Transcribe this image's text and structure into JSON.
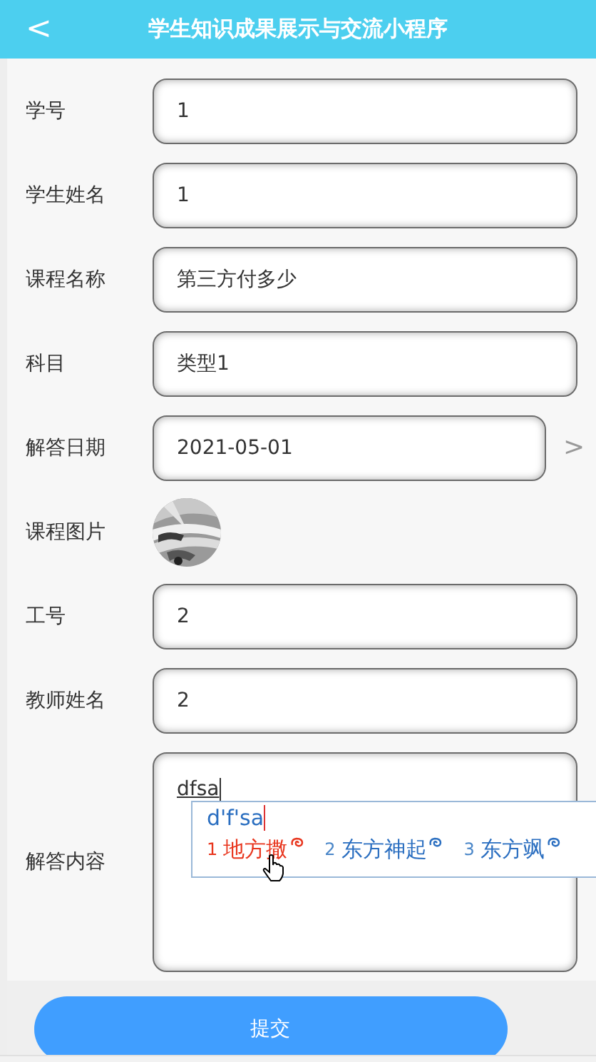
{
  "header": {
    "back": "<",
    "title": "学生知识成果展示与交流小程序"
  },
  "fields": [
    {
      "kind": "input",
      "label": "学号",
      "value": "1"
    },
    {
      "kind": "input",
      "label": "学生姓名",
      "value": "1"
    },
    {
      "kind": "input",
      "label": "课程名称",
      "value": "第三方付多少"
    },
    {
      "kind": "input",
      "label": "科目",
      "value": "类型1"
    },
    {
      "kind": "date",
      "label": "解答日期",
      "value": "2021-05-01",
      "chevron": ">"
    },
    {
      "label": "课程图片"
    },
    {
      "kind": "input",
      "label": "工号",
      "value": "2"
    },
    {
      "kind": "input",
      "label": "教师姓名",
      "value": "2"
    },
    {
      "kind": "textarea",
      "label": "解答内容",
      "value": "dfsa"
    }
  ],
  "ime": {
    "composition": "d'f'sa",
    "candidates": [
      {
        "index": "1",
        "text": "地方撒",
        "selected": true
      },
      {
        "index": "2",
        "text": "东方神起",
        "selected": false
      },
      {
        "index": "3",
        "text": "东方飒",
        "selected": false
      }
    ]
  },
  "submit": {
    "label": "提交"
  }
}
